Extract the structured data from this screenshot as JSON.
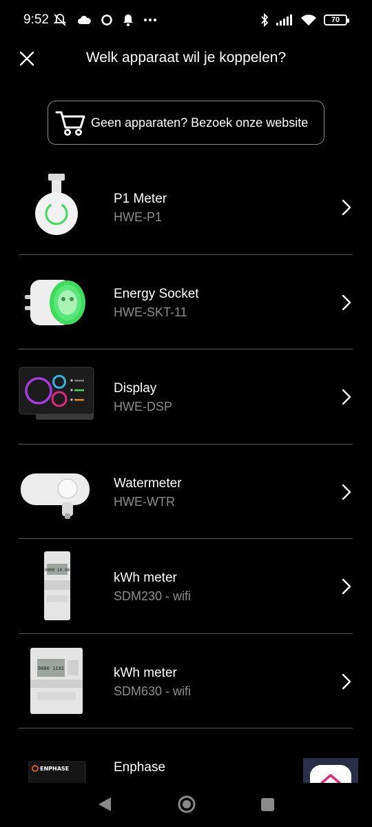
{
  "status_bar": {
    "time": "9:52",
    "battery": "70"
  },
  "header": {
    "title": "Welk apparaat wil je koppelen?"
  },
  "website_button": {
    "label": "Geen apparaten? Bezoek onze website"
  },
  "devices": [
    {
      "name": "P1 Meter",
      "model": "HWE-P1"
    },
    {
      "name": "Energy Socket",
      "model": "HWE-SKT-11"
    },
    {
      "name": "Display",
      "model": "HWE-DSP"
    },
    {
      "name": "Watermeter",
      "model": "HWE-WTR"
    },
    {
      "name": "kWh meter",
      "model": "SDM230 - wifi"
    },
    {
      "name": "kWh meter",
      "model": "SDM630 - wifi"
    },
    {
      "name": "Enphase",
      "model": ""
    }
  ],
  "device_images": {
    "sdm230_screen": "0000 10.00",
    "sdm630_screen": "0000 1192",
    "enphase_logo": "ENPHASE"
  },
  "colors": {
    "background": "#000000",
    "accent_green": "#3ddc5a",
    "secondary_text": "#8d8d8d",
    "fab_background": "#2a2f48",
    "fab_logo": "#e2266f"
  }
}
